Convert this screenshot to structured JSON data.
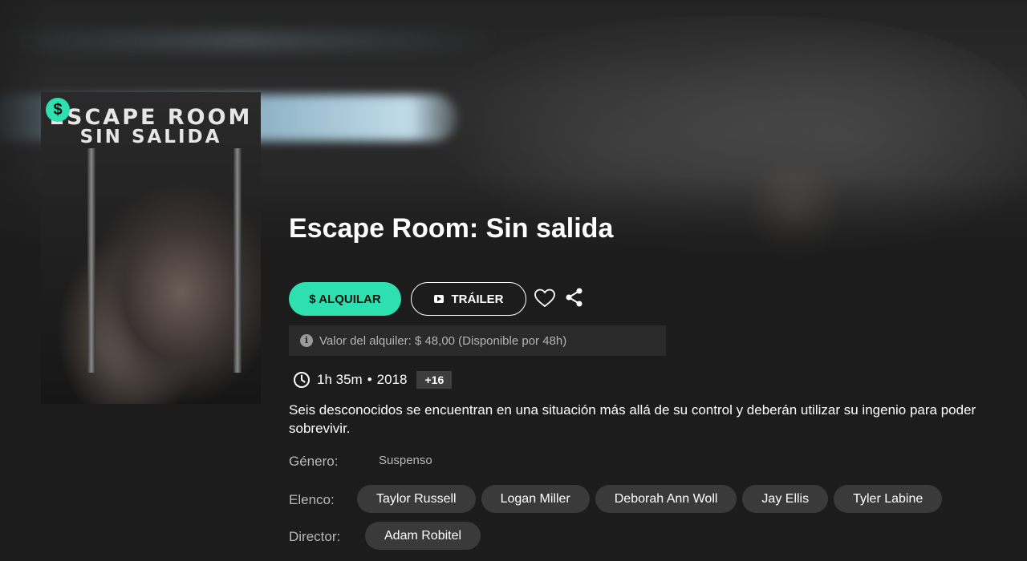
{
  "hero": {
    "poster": {
      "title_line1": "ESCAPE ROOM",
      "title_line2": "SIN SALIDA",
      "badge_symbol": "$"
    }
  },
  "movie": {
    "title": "Escape Room: Sin salida",
    "duration": "1h 35m",
    "separator": "•",
    "year": "2018",
    "rating": "+16",
    "synopsis": "Seis desconocidos se encuentran en una situación más allá de su control y deberán utilizar su ingenio para poder sobrevivir."
  },
  "actions": {
    "rent_label": "$ ALQUILAR",
    "trailer_label": "TRÁILER",
    "favorite_icon": "heart-icon",
    "share_icon": "share-icon"
  },
  "rental_note": {
    "icon": "info-icon",
    "text": "Valor del alquiler: $ 48,00 (Disponible por 48h)"
  },
  "details": {
    "genre_label": "Género:",
    "genre_value": "Suspenso",
    "cast_label": "Elenco:",
    "cast": [
      "Taylor Russell",
      "Logan Miller",
      "Deborah Ann Woll",
      "Jay Ellis",
      "Tyler Labine"
    ],
    "director_label": "Director:",
    "directors": [
      "Adam Robitel"
    ]
  },
  "colors": {
    "accent": "#2ee0b0",
    "background": "#1c1c1c",
    "chip": "#3a3a3a",
    "muted_text": "#b8b8b8"
  }
}
